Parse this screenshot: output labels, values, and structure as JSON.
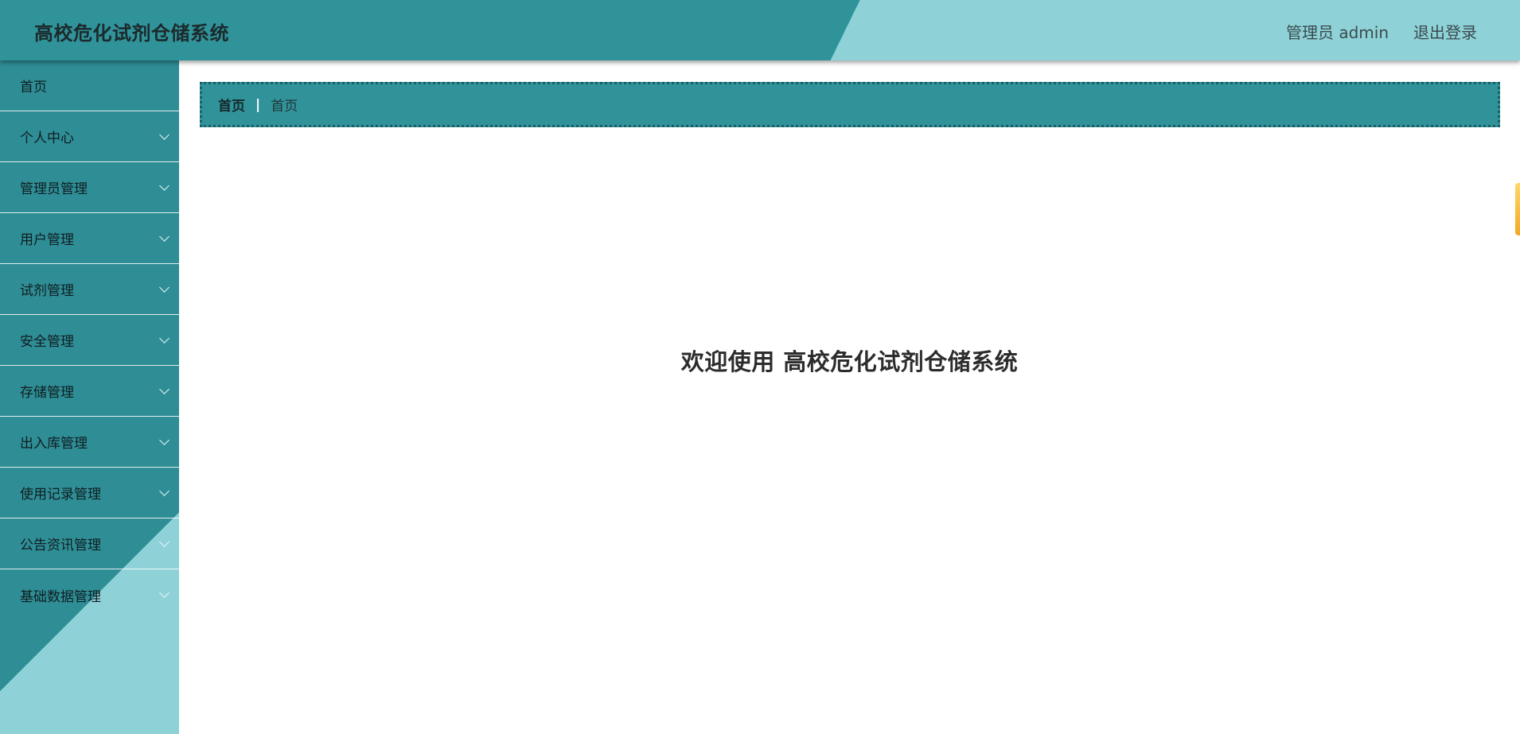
{
  "header": {
    "title": "高校危化试剂仓储系统",
    "user_label": "管理员 admin",
    "logout_label": "退出登录"
  },
  "sidebar": {
    "items": [
      {
        "label": "首页",
        "has_children": false
      },
      {
        "label": "个人中心",
        "has_children": true
      },
      {
        "label": "管理员管理",
        "has_children": true
      },
      {
        "label": "用户管理",
        "has_children": true
      },
      {
        "label": "试剂管理",
        "has_children": true
      },
      {
        "label": "安全管理",
        "has_children": true
      },
      {
        "label": "存储管理",
        "has_children": true
      },
      {
        "label": "出入库管理",
        "has_children": true
      },
      {
        "label": "使用记录管理",
        "has_children": true
      },
      {
        "label": "公告资讯管理",
        "has_children": true
      },
      {
        "label": "基础数据管理",
        "has_children": true
      }
    ]
  },
  "breadcrumb": {
    "home": "首页",
    "separator": "|",
    "current": "首页"
  },
  "main": {
    "welcome_text": "欢迎使用 高校危化试剂仓储系统"
  },
  "colors": {
    "primary": "#31939a",
    "accent_light": "#8ed2d8",
    "handle": "#f5a623"
  }
}
